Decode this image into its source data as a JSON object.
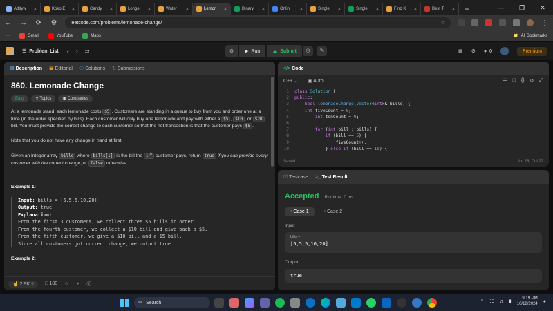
{
  "browser": {
    "tabs": [
      {
        "label": "Adityw",
        "color": "#8ab4f8"
      },
      {
        "label": "Koko E",
        "color": "#e8a33d"
      },
      {
        "label": "Candy",
        "color": "#e8a33d"
      },
      {
        "label": "Longe:",
        "color": "#e8a33d"
      },
      {
        "label": "Water",
        "color": "#e8a33d"
      },
      {
        "label": "Lemon",
        "color": "#e8a33d",
        "active": true
      },
      {
        "label": "Binary",
        "color": "#0f9d58"
      },
      {
        "label": "Onlin",
        "color": "#4285f4"
      },
      {
        "label": "Single",
        "color": "#e8a33d"
      },
      {
        "label": "Single",
        "color": "#0f9d58"
      },
      {
        "label": "Find K",
        "color": "#e8a33d"
      },
      {
        "label": "Best Ti",
        "color": "#c0392b"
      }
    ],
    "url": "leetcode.com/problems/lemonade-change/",
    "bookmarks": [
      "Gmail",
      "YouTube",
      "Maps"
    ],
    "all_bookmarks": "All Bookmarks"
  },
  "lc_header": {
    "problem_list": "Problem List",
    "run": "Run",
    "submit": "Submit",
    "streak": "0",
    "premium": "Premium"
  },
  "description_panel": {
    "tabs": [
      "Description",
      "Editorial",
      "Solutions",
      "Submissions"
    ],
    "title": "860. Lemonade Change",
    "difficulty": "Easy",
    "tags_label": "Topics",
    "companies_label": "Companies",
    "p1a": "At a lemonade stand, each lemonade costs ",
    "p1_cost": "$5",
    "p1b": ". Customers are standing in a queue to buy from you and order one at a time (in the order specified by bills). Each customer will only buy one lemonade and pay with either a ",
    "p1_b5": "$5",
    "p1c": ", ",
    "p1_b10": "$10",
    "p1d": ", or ",
    "p1_b20": "$20",
    "p1e": " bill. You must provide the correct change to each customer so that the net transaction is that the customer pays ",
    "p1_pay": "$5",
    "p1f": ".",
    "p2": "Note that you do not have any change in hand at first.",
    "p3a": "Given an integer array ",
    "p3_bills": "bills",
    "p3b": " where ",
    "p3_billsi": "bills[i]",
    "p3c": " is the bill the ",
    "p3_i": "i",
    "p3_th": "th",
    "p3d": " customer pays, return ",
    "p3_true": "true",
    "p3e": " if you can provide every customer with the correct change",
    "p3f": ", or ",
    "p3_false": "false",
    "p3g": " otherwise.",
    "example1_title": "Example 1:",
    "ex1_input_label": "Input:",
    "ex1_input": " bills = [5,5,5,10,20]",
    "ex1_output_label": "Output:",
    "ex1_output": " true",
    "ex1_expl_label": "Explanation:",
    "ex1_lines": [
      "From the first 3 customers, we collect three $5 bills in order.",
      "From the fourth customer, we collect a $10 bill and give back a $5.",
      "From the fifth customer, we give a $10 bill and a $5 bill.",
      "Since all customers got correct change, we output true."
    ],
    "example2_title": "Example 2:",
    "likes": "2.9K",
    "comments": "180"
  },
  "code_panel": {
    "title": "Code",
    "language": "C++",
    "autocomplete": "Auto",
    "saved": "Saved",
    "cursor": "Ln 28, Col 22",
    "lines": [
      {
        "n": "1",
        "t": "class Solution {"
      },
      {
        "n": "2",
        "t": "public:"
      },
      {
        "n": "3",
        "t": "    bool lemonadeChange(vector<int>& bills) {"
      },
      {
        "n": "4",
        "t": "    int fiveCount = 0;"
      },
      {
        "n": "5",
        "t": "        int tenCount = 0;"
      },
      {
        "n": "6",
        "t": ""
      },
      {
        "n": "7",
        "t": "        for (int bill : bills) {"
      },
      {
        "n": "8",
        "t": "            if (bill == 5) {"
      },
      {
        "n": "9",
        "t": "                fiveCount++;"
      },
      {
        "n": "10",
        "t": "            } else if (bill == 10) {"
      }
    ]
  },
  "test_panel": {
    "tab_testcase": "Testcase",
    "tab_result": "Test Result",
    "status": "Accepted",
    "runtime": "Runtime: 0 ms",
    "case1": "Case 1",
    "case2": "Case 2",
    "input_label": "Input",
    "var_name": "bills =",
    "var_value": "[5,5,5,10,20]",
    "output_label": "Output",
    "output_value": "true"
  },
  "taskbar": {
    "search": "Search",
    "time": "9:19 PM",
    "date": "10/18/2024"
  }
}
